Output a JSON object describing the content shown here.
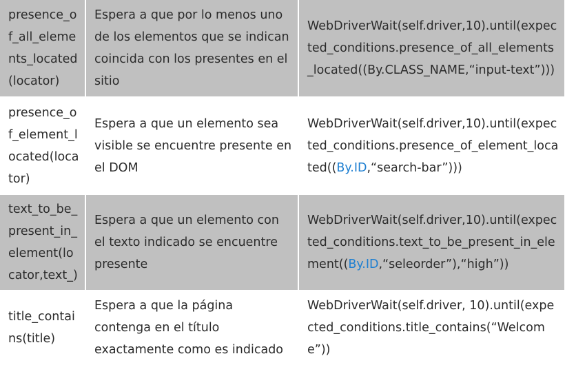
{
  "rows": [
    {
      "method": "presence_of_all_elements_located(locator)",
      "description": "Espera a que por lo menos uno de los elementos que se indican coincida con los presentes en el sitio",
      "code": {
        "pre": "WebDriverWait(self.driver,10).until(expected_conditions.presence_of_all_elements_located((",
        "link": "",
        "post": "By.CLASS_NAME,“input-text”)))"
      }
    },
    {
      "method": "presence_of_element_located(locator)",
      "description": "Espera a que un elemento sea visible se encuentre presente en el DOM",
      "code": {
        "pre": "WebDriverWait(self.driver,10).until(expected_conditions.presence_of_element_located((",
        "link": "By.ID",
        "post": ",“search-bar”)))"
      }
    },
    {
      "method": "text_to_be_present_in_element(locator,text_)",
      "description": "Espera a que un elemento con el texto indicado se encuentre presente",
      "code": {
        "pre": "WebDriverWait(self.driver,10).until(expected_conditions.text_to_be_present_in_element((",
        "link": "By.ID",
        "post": ",“seleorder”),“high”))"
      }
    },
    {
      "method": "title_contains(title)",
      "description": "Espera a que la página contenga en el título exactamente como es indicado",
      "code": {
        "pre": "WebDriverWait(self.driver, 10).until(expected_conditions.title_contains(“Welcome”))",
        "link": "",
        "post": ""
      }
    }
  ],
  "colors": {
    "row_shade": "#c0c0c0",
    "link": "#1e7fd1",
    "text": "#2b2b2b"
  }
}
